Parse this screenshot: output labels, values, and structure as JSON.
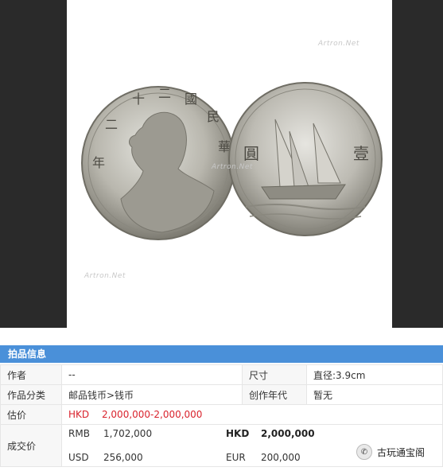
{
  "watermark": "Artron.Net",
  "obverse_text": [
    "年",
    "二",
    "十",
    "二",
    "國",
    "民",
    "華"
  ],
  "reverse_text": [
    "壹",
    "圓"
  ],
  "section_title": "拍品信息",
  "rows": {
    "author_label": "作者",
    "author_value": "--",
    "size_label": "尺寸",
    "size_value": "直径:3.9cm",
    "category_label": "作品分类",
    "category_value": "邮品钱币>钱币",
    "era_label": "创作年代",
    "era_value": "暂无",
    "estimate_label": "估价",
    "estimate_currency": "HKD",
    "estimate_value": "2,000,000-2,000,000",
    "deal_label": "成交价",
    "deal": {
      "rmb_cur": "RMB",
      "rmb_val": "1,702,000",
      "hkd_cur": "HKD",
      "hkd_val": "2,000,000",
      "usd_cur": "USD",
      "usd_val": "256,000",
      "eur_cur": "EUR",
      "eur_val": "200,000"
    }
  },
  "brand": "古玩通宝阁"
}
